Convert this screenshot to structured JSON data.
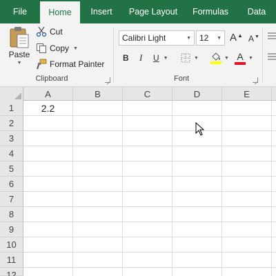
{
  "tabs": [
    {
      "label": "File",
      "active": false
    },
    {
      "label": "Home",
      "active": true
    },
    {
      "label": "Insert",
      "active": false
    },
    {
      "label": "Page Layout",
      "active": false
    },
    {
      "label": "Formulas",
      "active": false
    },
    {
      "label": "Data",
      "active": false
    }
  ],
  "clipboard": {
    "paste": "Paste",
    "cut": "Cut",
    "copy": "Copy",
    "format_painter": "Format Painter",
    "group_label": "Clipboard"
  },
  "font": {
    "name": "Calibri Light",
    "size": "12",
    "grow_label": "A",
    "shrink_label": "A",
    "bold": "B",
    "italic": "I",
    "underline": "U",
    "font_color_label": "A",
    "group_label": "Font",
    "highlight_color": "#ffff00",
    "font_color": "#e81123"
  },
  "grid": {
    "columns": [
      "A",
      "B",
      "C",
      "D",
      "E"
    ],
    "rows": [
      "1",
      "2",
      "3",
      "4",
      "5",
      "6",
      "7",
      "8",
      "9",
      "10",
      "11",
      "12"
    ],
    "a1_value": "2.2"
  },
  "colors": {
    "accent": "#217346",
    "ribbon_bg": "#f3f3f3"
  }
}
